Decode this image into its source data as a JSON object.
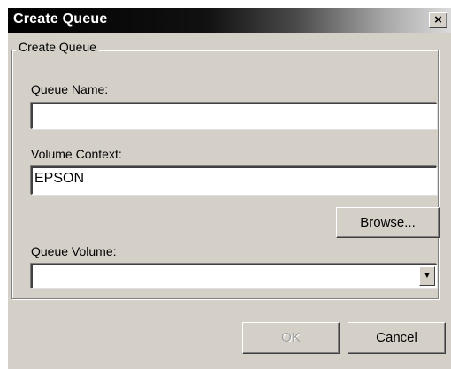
{
  "window": {
    "title": "Create Queue",
    "close_glyph": "×",
    "icons": {
      "close": "close-icon",
      "dropdown": "chevron-down-icon"
    }
  },
  "group": {
    "legend": "Create Queue",
    "queue_name": {
      "label": "Queue Name:",
      "value": ""
    },
    "volume_context": {
      "label": "Volume Context:",
      "value": "EPSON"
    },
    "browse_label": "Browse...",
    "queue_volume": {
      "label": "Queue Volume:",
      "selected": "",
      "arrow": "▼"
    }
  },
  "buttons": {
    "ok": "OK",
    "ok_enabled": false,
    "cancel": "Cancel"
  }
}
